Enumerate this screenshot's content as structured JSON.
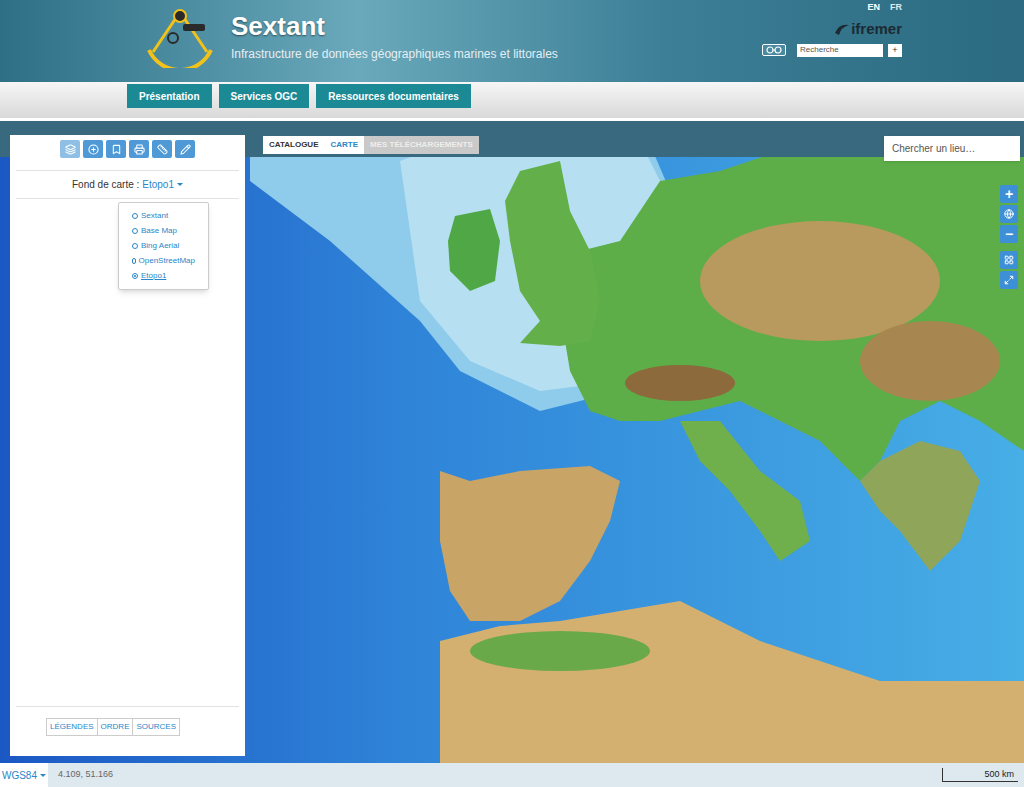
{
  "header": {
    "title": "Sextant",
    "subtitle": "Infrastructure de données géographiques marines et littorales",
    "languages": [
      {
        "label": "EN",
        "selected": true
      },
      {
        "label": "FR",
        "selected": false
      }
    ],
    "brand": "ifremer",
    "search": {
      "placeholder": "Recherche",
      "button": "+"
    }
  },
  "nav": [
    {
      "label": "Présentation"
    },
    {
      "label": "Services OGC"
    },
    {
      "label": "Ressources documentaires"
    }
  ],
  "view_tabs": [
    {
      "label": "CATALOGUE",
      "selected": false,
      "disabled": false
    },
    {
      "label": "CARTE",
      "selected": true,
      "disabled": false
    },
    {
      "label": "MES TÉLÉCHARGEMENTS",
      "selected": false,
      "disabled": true
    }
  ],
  "place_search": {
    "placeholder": "Chercher un lieu…"
  },
  "panel": {
    "toolbar": [
      {
        "kind": "layers",
        "selected": true
      },
      {
        "kind": "add",
        "selected": false
      },
      {
        "kind": "bookmark",
        "selected": false
      },
      {
        "kind": "print",
        "selected": false
      },
      {
        "kind": "measure",
        "selected": false
      },
      {
        "kind": "draw",
        "selected": false
      }
    ],
    "basemap": {
      "label": "Fond de carte :",
      "value": "Etopo1",
      "menu_open": true,
      "options": [
        {
          "label": "Sextant",
          "selected": false
        },
        {
          "label": "Base Map",
          "selected": false
        },
        {
          "label": "Bing Aerial",
          "selected": false
        },
        {
          "label": "OpenStreetMap",
          "selected": false
        },
        {
          "label": "Etopo1",
          "selected": true
        }
      ]
    },
    "bottom_tabs": [
      {
        "label": "LÉGENDES"
      },
      {
        "label": "ORDRE"
      },
      {
        "label": "SOURCES"
      }
    ]
  },
  "map_controls": [
    {
      "kind": "text",
      "label": "+"
    },
    {
      "kind": "globe",
      "label": ""
    },
    {
      "kind": "text",
      "label": "−"
    },
    {
      "kind": "grid",
      "label": ""
    },
    {
      "kind": "fullscreen",
      "label": ""
    }
  ],
  "status_bar": {
    "projection": "WGS84",
    "coordinates": "4.109, 51.166",
    "scale": "500 km"
  }
}
